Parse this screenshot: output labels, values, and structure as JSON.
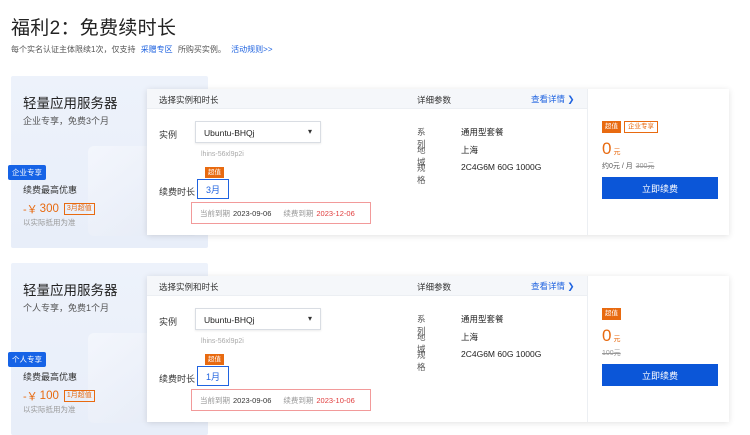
{
  "page": {
    "title": "福利2：免费续时长",
    "subline_text": "每个实名认证主体限续1次，仅支持",
    "subline_link1": "采赠专区",
    "subline_text2": "所购买实例。",
    "subline_link2": "活动规则>>"
  },
  "cards": [
    {
      "promo": {
        "title": "轻量应用服务器",
        "subtitle": "企业专享，免费3个月",
        "badge": "企业专享",
        "renew_label": "续费最高优惠",
        "price_prefix": "-￥",
        "price": "300",
        "price_tag": "3月超值",
        "note": "以实际抵用为准"
      },
      "header": {
        "left": "选择实例和时长",
        "mid": "详细参数",
        "link": "查看详情 ❯"
      },
      "instance": {
        "label": "实例",
        "selected": "Ubuntu-BHQj",
        "caret": "▾",
        "id": "lhins-56xl9p2i"
      },
      "duration": {
        "label": "续费时长",
        "tag": "超值",
        "value": "3月"
      },
      "expire": {
        "current_label": "当前到期",
        "current_date": "2023-09-06",
        "renew_label": "续费到期",
        "renew_date": "2023-12-06"
      },
      "specs": [
        {
          "key": "系列",
          "value": "通用型套餐"
        },
        {
          "key": "地域",
          "value": "上海"
        },
        {
          "key": "规格",
          "value": "2C4G6M 60G 1000G"
        }
      ],
      "pricing": {
        "badge1": "超值",
        "badge2": "企业专享",
        "price": "0",
        "unit": "元",
        "per_month": "约0元 / 月",
        "original": "300元",
        "button": "立即续费"
      }
    },
    {
      "promo": {
        "title": "轻量应用服务器",
        "subtitle": "个人专享，免费1个月",
        "badge": "个人专享",
        "renew_label": "续费最高优惠",
        "price_prefix": "-￥",
        "price": "100",
        "price_tag": "1月超值",
        "note": "以实际抵用为准"
      },
      "header": {
        "left": "选择实例和时长",
        "mid": "详细参数",
        "link": "查看详情 ❯"
      },
      "instance": {
        "label": "实例",
        "selected": "Ubuntu-BHQj",
        "caret": "▾",
        "id": "lhins-56xl9p2i"
      },
      "duration": {
        "label": "续费时长",
        "tag": "超值",
        "value": "1月"
      },
      "expire": {
        "current_label": "当前到期",
        "current_date": "2023-09-06",
        "renew_label": "续费到期",
        "renew_date": "2023-10-06"
      },
      "specs": [
        {
          "key": "系列",
          "value": "通用型套餐"
        },
        {
          "key": "地域",
          "value": "上海"
        },
        {
          "key": "规格",
          "value": "2C4G6M 60G 1000G"
        }
      ],
      "pricing": {
        "badge1": "超值",
        "price": "0",
        "unit": "元",
        "original": "100元",
        "button": "立即续费"
      }
    }
  ],
  "colors": {
    "accent_blue": "#1f63e0",
    "button_blue": "#0b56d8",
    "orange": "#e86a10",
    "red": "#e03c3c"
  }
}
